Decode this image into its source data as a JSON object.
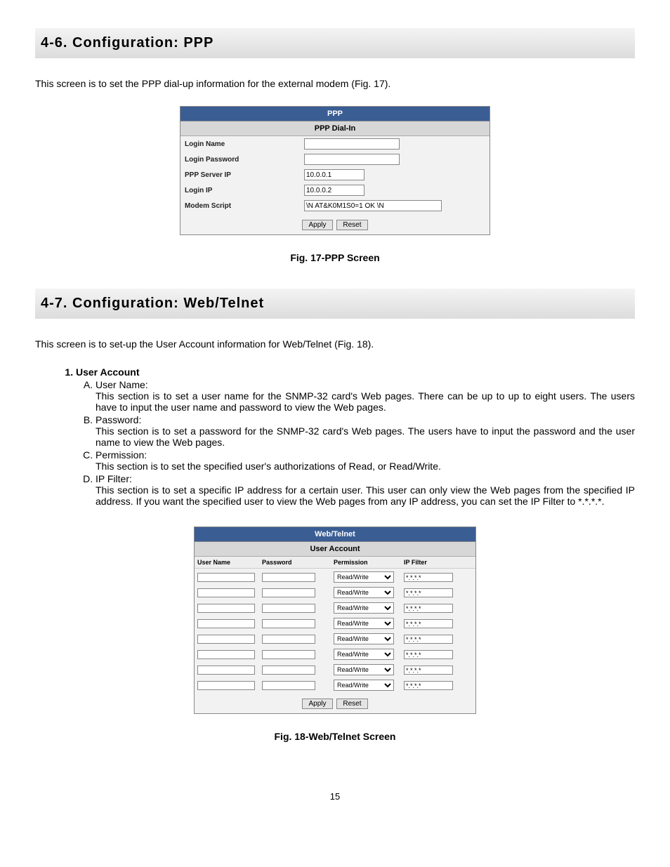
{
  "section46": {
    "title": "4-6. Configuration: PPP",
    "intro": "This screen is to set the PPP dial-up information for the external modem (Fig. 17).",
    "panel_title": "PPP",
    "panel_sub": "PPP Dial-In",
    "rows": {
      "login_name": "Login Name",
      "login_password": "Login Password",
      "ppp_server_ip": "PPP Server IP",
      "login_ip": "Login IP",
      "modem_script": "Modem Script"
    },
    "values": {
      "login_name": "",
      "login_password": "",
      "ppp_server_ip": "10.0.0.1",
      "login_ip": "10.0.0.2",
      "modem_script": "\\N AT&K0M1S0=1 OK \\N"
    },
    "apply": "Apply",
    "reset": "Reset",
    "caption": "Fig. 17-PPP Screen"
  },
  "section47": {
    "title": "4-7. Configuration: Web/Telnet",
    "intro": "This screen is to set-up the User Account information for Web/Telnet (Fig. 18).",
    "list_head": "User Account",
    "items": {
      "a_label": "User Name:",
      "a_body": "This section is to set a user name for the SNMP-32 card's Web pages.  There can be up to up to eight users.  The users have to input the user name and password to view the Web pages.",
      "b_label": "Password:",
      "b_body": "This section is to set a password for the SNMP-32 card's Web pages.  The users have to input the password and the user name to view the Web pages.",
      "c_label": "Permission:",
      "c_body": "This section is to set the specified user's authorizations of Read, or Read/Write.",
      "d_label": "IP Filter:",
      "d_body": "This section is to set a specific IP address for a certain user.  This user can only view the Web pages from the specified IP address.  If you want the specified user to view the Web pages from any IP address, you can set the IP Filter to *.*.*.*."
    },
    "panel_title": "Web/Telnet",
    "panel_sub": "User Account",
    "cols": {
      "c1": "User Name",
      "c2": "Password",
      "c3": "Permission",
      "c4": "IP Filter"
    },
    "row": {
      "user": "",
      "pass": "",
      "perm": "Read/Write",
      "ipf": "*.*.*.*"
    },
    "apply": "Apply",
    "reset": "Reset",
    "caption": "Fig. 18-Web/Telnet Screen"
  },
  "page_number": "15"
}
